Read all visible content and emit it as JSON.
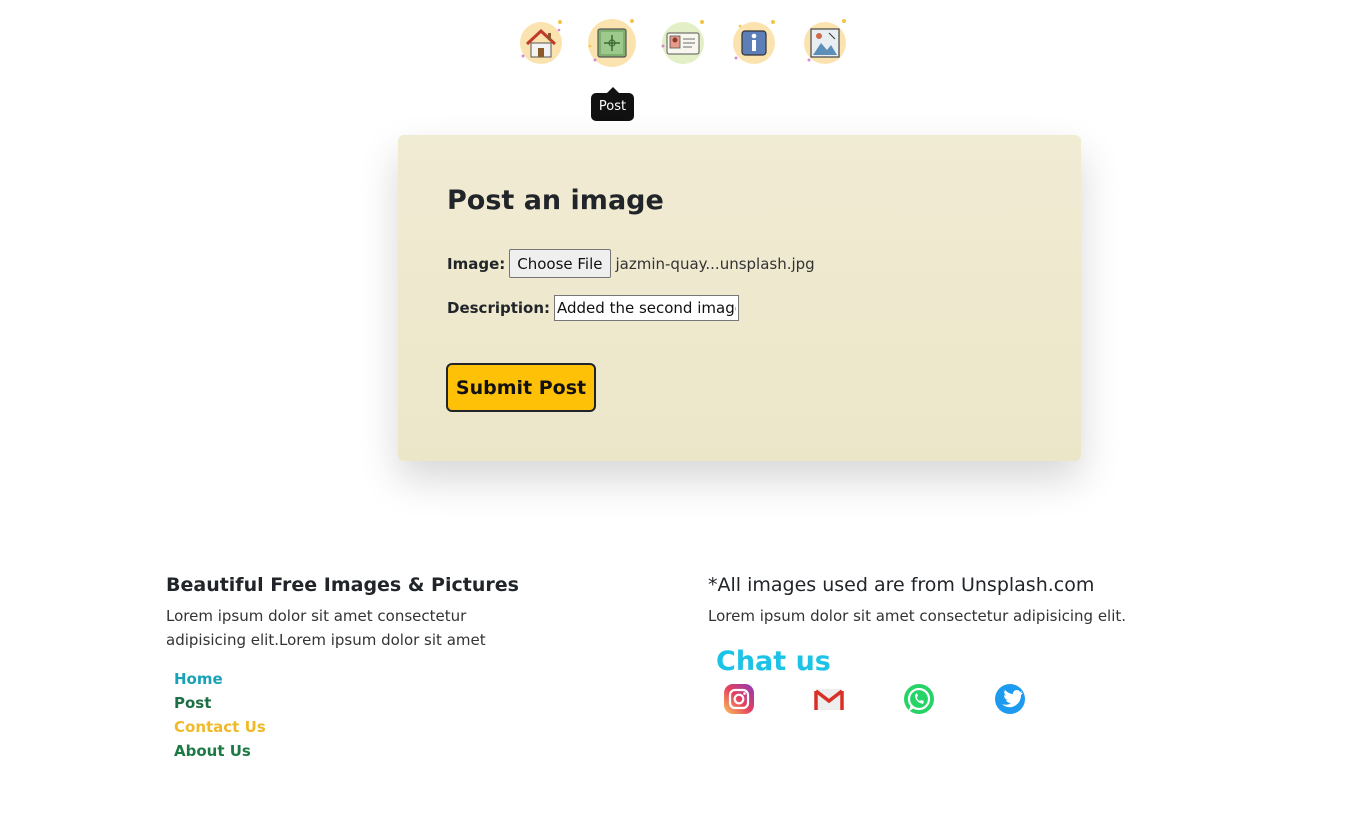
{
  "nav": {
    "items": [
      {
        "name": "home",
        "icon": "house-icon"
      },
      {
        "name": "post",
        "icon": "add-image-icon"
      },
      {
        "name": "contact",
        "icon": "id-card-icon"
      },
      {
        "name": "about",
        "icon": "info-icon"
      },
      {
        "name": "gallery",
        "icon": "picture-icon"
      }
    ],
    "tooltip": "Post"
  },
  "form": {
    "title": "Post an image",
    "image_label": "Image:",
    "file_button": "Choose File",
    "file_name": "jazmin-quay...unsplash.jpg",
    "description_label": "Description:",
    "description_value": "Added the second image",
    "submit_label": "Submit Post",
    "card_color": "#ede7cc",
    "submit_color": "#ffc107"
  },
  "footer": {
    "left_title": "Beautiful Free Images & Pictures",
    "left_text": "Lorem ipsum dolor sit amet consectetur adipisicing elit.Lorem ipsum dolor sit amet",
    "links": [
      {
        "label": "Home",
        "color": "#17a2b8"
      },
      {
        "label": "Post",
        "color": "#1e6f45"
      },
      {
        "label": "Contact Us",
        "color": "#f0b92a"
      },
      {
        "label": "About Us",
        "color": "#1e7a45"
      }
    ],
    "right_title": "*All images used are from Unsplash.com",
    "right_text": "Lorem ipsum dolor sit amet consectetur adipisicing elit.",
    "chat_title": "Chat us",
    "chat_color": "#1cc3e6",
    "social": [
      "instagram-icon",
      "gmail-icon",
      "whatsapp-icon",
      "twitter-icon"
    ]
  }
}
